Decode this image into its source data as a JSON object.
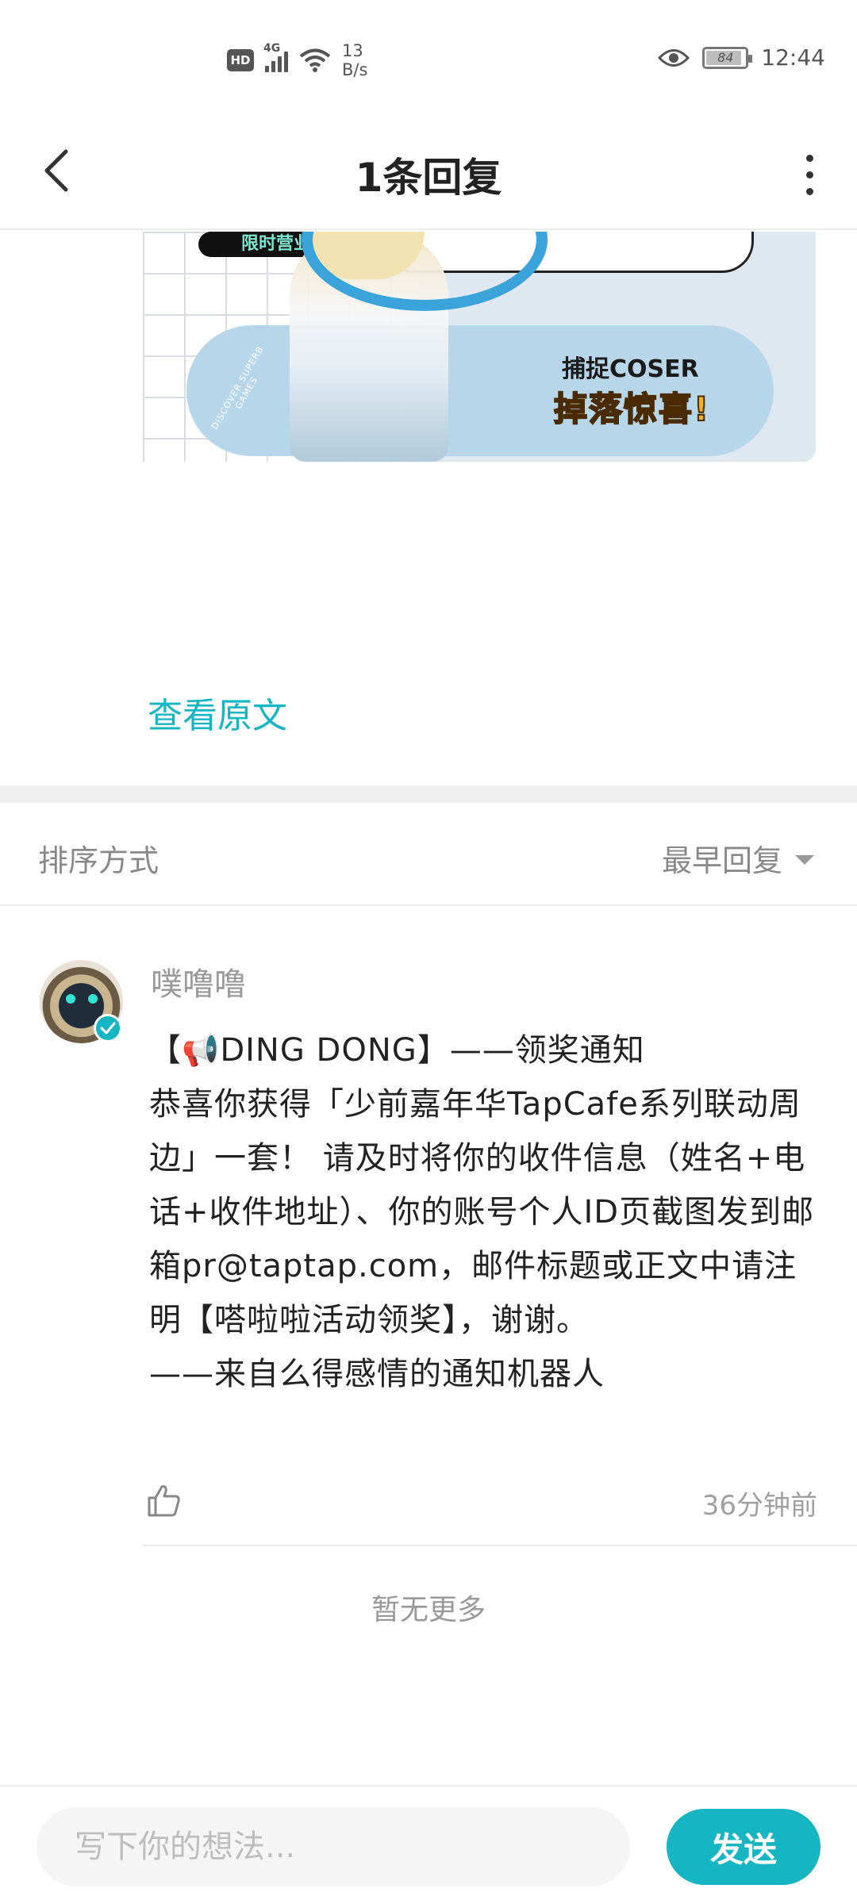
{
  "status_bar": {
    "hd": "HD",
    "network": "4G",
    "speed_value": "13",
    "speed_unit": "B/s",
    "battery": "84",
    "time": "12:44"
  },
  "header": {
    "title": "1条回复"
  },
  "banner": {
    "tag": "限时营业",
    "line1": "捕捉COSER",
    "line2": "掉落惊喜!",
    "circle_text": "DISCOVER SUPERB GAMES"
  },
  "view_original": "查看原文",
  "sort": {
    "label": "排序方式",
    "value": "最早回复"
  },
  "comment": {
    "username": "噗噜噜",
    "body_line1_prefix": "【",
    "body_line1_icon": "📢",
    "body_line1_rest": "DING DONG】——领奖通知",
    "body": "恭喜你获得「少前嘉年华TapCafe系列联动周边」一套！ 请及时将你的收件信息（姓名+电话+收件地址）、你的账号个人ID页截图发到邮箱pr@taptap.com，邮件标题或正文中请注明【嗒啦啦活动领奖】，谢谢。\n——来自么得感情的通知机器人",
    "time_ago": "36分钟前"
  },
  "no_more": "暂无更多",
  "input": {
    "placeholder": "写下你的想法...",
    "send_label": "发送"
  },
  "colors": {
    "accent": "#15b6c2"
  }
}
